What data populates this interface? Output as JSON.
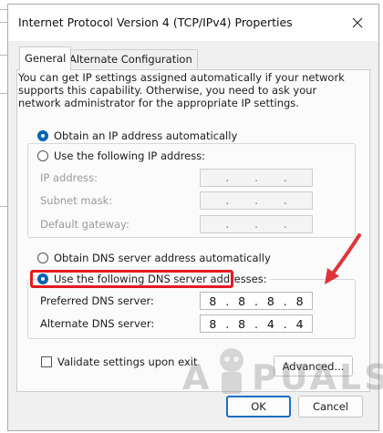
{
  "window": {
    "title": "Internet Protocol Version 4 (TCP/IPv4) Properties"
  },
  "tabs": [
    {
      "label": "General",
      "active": true
    },
    {
      "label": "Alternate Configuration",
      "active": false
    }
  ],
  "general": {
    "description": "You can get IP settings assigned automatically if your network supports this capability. Otherwise, you need to ask your network administrator for the appropriate IP settings.",
    "ip": {
      "auto_label": "Obtain an IP address automatically",
      "auto_selected": true,
      "manual_label": "Use the following IP address:",
      "manual_selected": false,
      "fields": [
        {
          "label": "IP address:",
          "octets": [
            "",
            "",
            "",
            ""
          ],
          "enabled": false
        },
        {
          "label": "Subnet mask:",
          "octets": [
            "",
            "",
            "",
            ""
          ],
          "enabled": false
        },
        {
          "label": "Default gateway:",
          "octets": [
            "",
            "",
            "",
            ""
          ],
          "enabled": false
        }
      ]
    },
    "dns": {
      "auto_label": "Obtain DNS server address automatically",
      "auto_selected": false,
      "manual_label": "Use the following DNS server addresses:",
      "manual_selected": true,
      "preferred": {
        "label": "Preferred DNS server:",
        "octets": [
          "8",
          "8",
          "8",
          "8"
        ]
      },
      "alternate": {
        "label": "Alternate DNS server:",
        "octets": [
          "8",
          "8",
          "4",
          "4"
        ]
      }
    },
    "validate_label": "Validate settings upon exit",
    "validate_checked": false,
    "advanced_label": "Advanced..."
  },
  "footer": {
    "ok_label": "OK",
    "cancel_label": "Cancel"
  },
  "watermark": {
    "left": "A",
    "right": "PUALS"
  },
  "colors": {
    "accent": "#0063b1",
    "highlight": "#e31b23",
    "arrow": "#e0343a"
  },
  "icons": {
    "close": "close-icon",
    "arrow": "red-arrow-icon",
    "mascot": "appuals-mascot-icon"
  }
}
